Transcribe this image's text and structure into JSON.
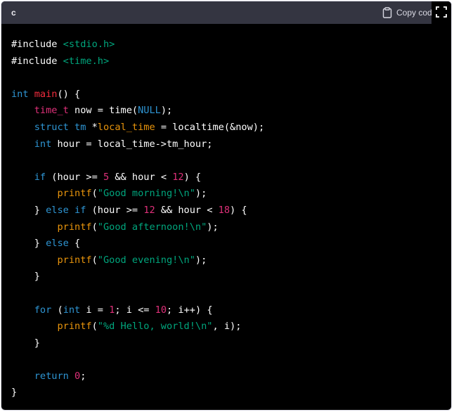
{
  "header": {
    "language": "c",
    "copy_label": "Copy code"
  },
  "icons": {
    "copy": "clipboard-icon",
    "expand": "fullscreen-icon"
  },
  "code_lines": [
    [
      [
        "pp",
        "#include "
      ],
      [
        "hdr",
        "<stdio.h>"
      ]
    ],
    [
      [
        "pp",
        "#include "
      ],
      [
        "hdr",
        "<time.h>"
      ]
    ],
    [],
    [
      [
        "kw",
        "int"
      ],
      [
        "pl",
        " "
      ],
      [
        "fn",
        "main"
      ],
      [
        "pl",
        "() {"
      ]
    ],
    [
      [
        "pl",
        "    "
      ],
      [
        "type",
        "time_t"
      ],
      [
        "pl",
        " now = time("
      ],
      [
        "null",
        "NULL"
      ],
      [
        "pl",
        ");"
      ]
    ],
    [
      [
        "pl",
        "    "
      ],
      [
        "kw",
        "struct"
      ],
      [
        "pl",
        " "
      ],
      [
        "cls",
        "tm"
      ],
      [
        "pl",
        " *"
      ],
      [
        "name",
        "local_time"
      ],
      [
        "pl",
        " = localtime(&now);"
      ]
    ],
    [
      [
        "pl",
        "    "
      ],
      [
        "kw",
        "int"
      ],
      [
        "pl",
        " hour = local_time->tm_hour;"
      ]
    ],
    [],
    [
      [
        "pl",
        "    "
      ],
      [
        "kw",
        "if"
      ],
      [
        "pl",
        " (hour >= "
      ],
      [
        "num",
        "5"
      ],
      [
        "pl",
        " && hour < "
      ],
      [
        "num",
        "12"
      ],
      [
        "pl",
        ") {"
      ]
    ],
    [
      [
        "pl",
        "        "
      ],
      [
        "call",
        "printf"
      ],
      [
        "pl",
        "("
      ],
      [
        "str",
        "\"Good morning!\\n\""
      ],
      [
        "pl",
        ");"
      ]
    ],
    [
      [
        "pl",
        "    } "
      ],
      [
        "kw",
        "else"
      ],
      [
        "pl",
        " "
      ],
      [
        "kw",
        "if"
      ],
      [
        "pl",
        " (hour >= "
      ],
      [
        "num",
        "12"
      ],
      [
        "pl",
        " && hour < "
      ],
      [
        "num",
        "18"
      ],
      [
        "pl",
        ") {"
      ]
    ],
    [
      [
        "pl",
        "        "
      ],
      [
        "call",
        "printf"
      ],
      [
        "pl",
        "("
      ],
      [
        "str",
        "\"Good afternoon!\\n\""
      ],
      [
        "pl",
        ");"
      ]
    ],
    [
      [
        "pl",
        "    } "
      ],
      [
        "kw",
        "else"
      ],
      [
        "pl",
        " {"
      ]
    ],
    [
      [
        "pl",
        "        "
      ],
      [
        "call",
        "printf"
      ],
      [
        "pl",
        "("
      ],
      [
        "str",
        "\"Good evening!\\n\""
      ],
      [
        "pl",
        ");"
      ]
    ],
    [
      [
        "pl",
        "    }"
      ]
    ],
    [],
    [
      [
        "pl",
        "    "
      ],
      [
        "kw",
        "for"
      ],
      [
        "pl",
        " ("
      ],
      [
        "kw",
        "int"
      ],
      [
        "pl",
        " i = "
      ],
      [
        "num",
        "1"
      ],
      [
        "pl",
        "; i <= "
      ],
      [
        "num",
        "10"
      ],
      [
        "pl",
        "; i++) {"
      ]
    ],
    [
      [
        "pl",
        "        "
      ],
      [
        "call",
        "printf"
      ],
      [
        "pl",
        "("
      ],
      [
        "str",
        "\"%d Hello, world!\\n\""
      ],
      [
        "pl",
        ", i);"
      ]
    ],
    [
      [
        "pl",
        "    }"
      ]
    ],
    [],
    [
      [
        "pl",
        "    "
      ],
      [
        "kw",
        "return"
      ],
      [
        "pl",
        " "
      ],
      [
        "num",
        "0"
      ],
      [
        "pl",
        ";"
      ]
    ],
    [
      [
        "pl",
        "}"
      ]
    ]
  ],
  "colors": {
    "keyword": "#2e95d3",
    "function": "#f22c3d",
    "type": "#df3079",
    "string": "#00a67d",
    "number": "#df3079",
    "call": "#e9950c",
    "header_bg": "#343541",
    "code_bg": "#000000"
  }
}
